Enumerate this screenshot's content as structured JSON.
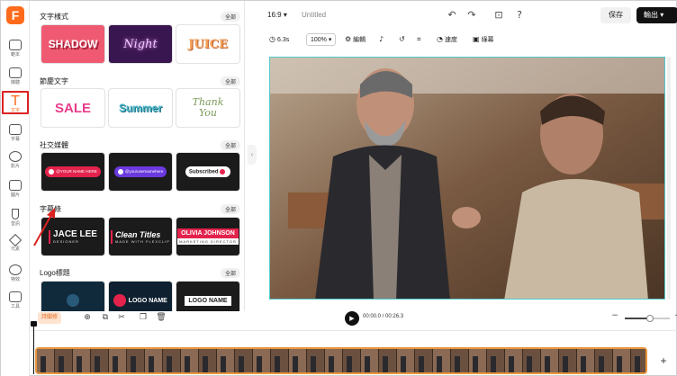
{
  "rail": {
    "logo": "F",
    "items": [
      {
        "label": "範本",
        "icon": "template-icon"
      },
      {
        "label": "媒體",
        "icon": "media-icon"
      },
      {
        "label": "文字",
        "icon": "text-icon",
        "active": true
      },
      {
        "label": "字幕",
        "icon": "subtitle-icon"
      },
      {
        "label": "影片",
        "icon": "video-icon"
      },
      {
        "label": "圖片",
        "icon": "image-icon"
      },
      {
        "label": "音訊",
        "icon": "audio-icon"
      },
      {
        "label": "元素",
        "icon": "elements-icon"
      },
      {
        "label": "特效",
        "icon": "effects-icon"
      },
      {
        "label": "工具",
        "icon": "tools-icon"
      }
    ]
  },
  "panel": {
    "sections": [
      {
        "title": "文字樣式",
        "all": "全部",
        "tiles": [
          "SHADOW",
          "Night",
          "JUICE"
        ]
      },
      {
        "title": "節慶文字",
        "all": "全部",
        "tiles": [
          "SALE",
          "Summer",
          "Thank You"
        ]
      },
      {
        "title": "社交媒體",
        "all": "全部",
        "tiles": [
          "@YOUR NAME HERE",
          "@yourusernamehere",
          "Subscribed"
        ]
      },
      {
        "title": "字幕條",
        "all": "全部",
        "tiles": [
          "JACE LEE",
          "Clean Titles",
          "OLIVIA JOHNSON"
        ],
        "subs": [
          "DESIGNER",
          "MADE WITH FLEXCLIP",
          "MARKETING DIRECTOR"
        ]
      },
      {
        "title": "Logo標題",
        "all": "全部",
        "tiles": [
          "",
          "LOGO NAME",
          "LOGO NAME"
        ]
      }
    ]
  },
  "topbar": {
    "ratio": "16:9",
    "title": "Untitled",
    "save": "保存",
    "export": "輸出"
  },
  "toolbar": {
    "duration": "6.3s",
    "zoom": "100%",
    "edit": "編輯",
    "speed": "速度",
    "transition": "綠幕"
  },
  "timeline": {
    "tag": "詩闡修",
    "time": "00:00.0 / 00:26.3",
    "zoom_level": 0.55
  },
  "colors": {
    "brand": "#ff6b1a",
    "canvas_border": "#52c9cc",
    "track_border": "#e9953e"
  }
}
